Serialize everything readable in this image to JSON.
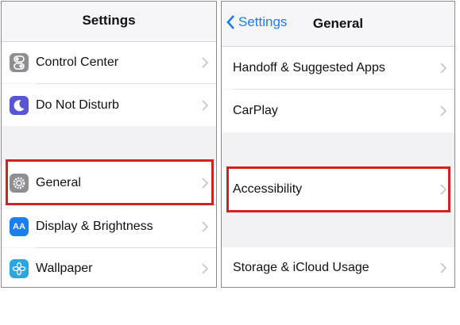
{
  "left_screen": {
    "title": "Settings",
    "items": [
      {
        "label": "Control Center",
        "icon": "control-center-icon",
        "color": "#8e8e93"
      },
      {
        "label": "Do Not Disturb",
        "icon": "moon-icon",
        "color": "#5856d6"
      },
      {
        "label": "General",
        "icon": "gear-icon",
        "color": "#8e8e93",
        "highlighted": true
      },
      {
        "label": "Display & Brightness",
        "icon": "display-brightness-icon",
        "color": "#1a7ef0",
        "icon_text": "AA"
      },
      {
        "label": "Wallpaper",
        "icon": "wallpaper-icon",
        "color": "#2aa7e3"
      }
    ]
  },
  "right_screen": {
    "back_label": "Settings",
    "title": "General",
    "items": [
      {
        "label": "Handoff & Suggested Apps"
      },
      {
        "label": "CarPlay"
      },
      {
        "label": "Accessibility",
        "highlighted": true
      },
      {
        "label": "Storage & iCloud Usage"
      }
    ]
  },
  "colors": {
    "accent": "#1a7ef0",
    "highlight_box": "#d42020",
    "group_background": "#f2f2f4"
  }
}
